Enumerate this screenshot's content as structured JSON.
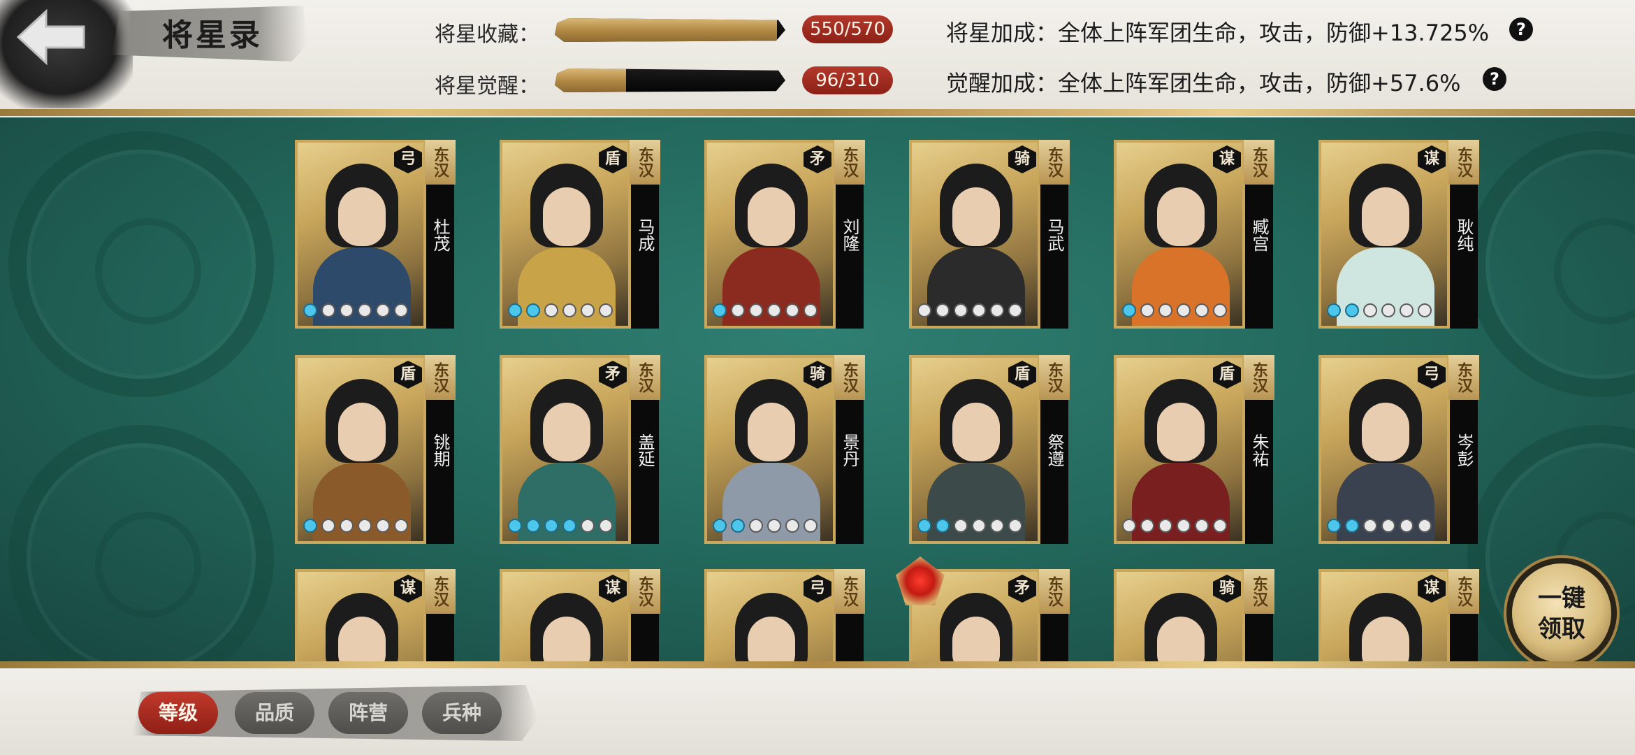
{
  "header": {
    "title": "将星录",
    "collection_label": "将星收藏：",
    "collection_count": "550/570",
    "collection_progress": 0.965,
    "awaken_label": "将星觉醒：",
    "awaken_count": "96/310",
    "awaken_progress": 0.31,
    "collection_bonus": "将星加成：全体上阵军团生命，攻击，防御+13.725%",
    "awaken_bonus": "觉醒加成：全体上阵军团生命，攻击，防御+57.6%",
    "help_glyph": "?"
  },
  "colors": {
    "accent_red": "#b4382b",
    "gold": "#c9a75c",
    "panel_green": "#246a5e",
    "star_on": "#4cc6ea"
  },
  "generals": [
    {
      "name": "杜茂",
      "type": "弓",
      "faction": "东汉",
      "awakened": 1,
      "robe": "#2d4a6b"
    },
    {
      "name": "马成",
      "type": "盾",
      "faction": "东汉",
      "awakened": 2,
      "robe": "#c9a347"
    },
    {
      "name": "刘隆",
      "type": "矛",
      "faction": "东汉",
      "awakened": 1,
      "robe": "#8b2a1e"
    },
    {
      "name": "马武",
      "type": "骑",
      "faction": "东汉",
      "awakened": 0,
      "robe": "#2b2b2b"
    },
    {
      "name": "臧宫",
      "type": "谋",
      "faction": "东汉",
      "awakened": 1,
      "robe": "#d9732a"
    },
    {
      "name": "耿纯",
      "type": "谋",
      "faction": "东汉",
      "awakened": 2,
      "robe": "#cfe6e0"
    },
    {
      "name": "铫期",
      "type": "盾",
      "faction": "东汉",
      "awakened": 1,
      "robe": "#8a5a2a"
    },
    {
      "name": "盖延",
      "type": "矛",
      "faction": "东汉",
      "awakened": 4,
      "robe": "#2f6e66"
    },
    {
      "name": "景丹",
      "type": "骑",
      "faction": "东汉",
      "awakened": 2,
      "robe": "#8f9aa8"
    },
    {
      "name": "祭遵",
      "type": "盾",
      "faction": "东汉",
      "awakened": 2,
      "robe": "#3c4a4a"
    },
    {
      "name": "朱祐",
      "type": "盾",
      "faction": "东汉",
      "awakened": 0,
      "robe": "#7a1f1f"
    },
    {
      "name": "岑彭",
      "type": "弓",
      "faction": "东汉",
      "awakened": 2,
      "robe": "#3a4250"
    },
    {
      "name": "",
      "type": "谋",
      "faction": "东汉",
      "awakened": 0,
      "robe": "#3a4a55"
    },
    {
      "name": "",
      "type": "谋",
      "faction": "东汉",
      "awakened": 0,
      "robe": "#6a5a40"
    },
    {
      "name": "",
      "type": "弓",
      "faction": "东汉",
      "awakened": 0,
      "robe": "#8a8a8a"
    },
    {
      "name": "",
      "type": "矛",
      "faction": "东汉",
      "awakened": 0,
      "robe": "#3a3a3a"
    },
    {
      "name": "",
      "type": "骑",
      "faction": "东汉",
      "awakened": 0,
      "robe": "#5a6f9a"
    },
    {
      "name": "",
      "type": "谋",
      "faction": "东汉",
      "awakened": 0,
      "robe": "#c96a2a"
    }
  ],
  "stars_per_general": 6,
  "claim_button": "一键\n领取",
  "tabs": [
    {
      "label": "等级",
      "active": true
    },
    {
      "label": "品质",
      "active": false
    },
    {
      "label": "阵营",
      "active": false
    },
    {
      "label": "兵种",
      "active": false
    }
  ],
  "icons": {
    "back": "back-arrow-icon",
    "help": "question-icon",
    "new_gem": "red-gem-icon"
  }
}
